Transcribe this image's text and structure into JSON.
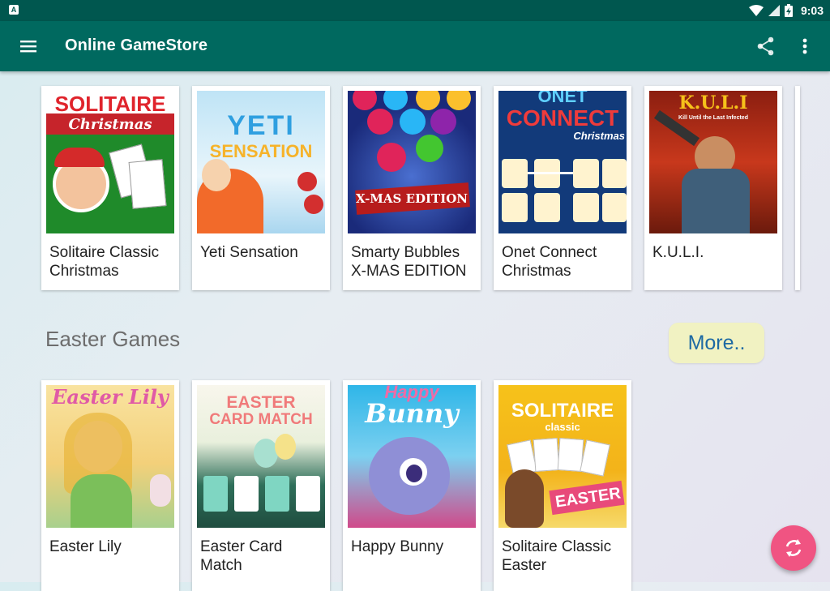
{
  "status_bar": {
    "time": "9:03",
    "left_icon_letter": "A"
  },
  "app_bar": {
    "title": "Online GameStore",
    "icons": [
      "menu-icon",
      "share-icon",
      "more-vert-icon"
    ]
  },
  "sections": [
    {
      "games": [
        {
          "title": "Solitaire Classic Christmas",
          "art": [
            "SOLITAIRE",
            "Christmas"
          ]
        },
        {
          "title": "Yeti Sensation",
          "art": [
            "YETI",
            "SENSATION"
          ]
        },
        {
          "title": "Smarty Bubbles X-MAS EDITION",
          "art": [
            "X-MAS EDITION"
          ]
        },
        {
          "title": "Onet Connect Christmas",
          "art": [
            "ONET",
            "CONNECT",
            "Christmas"
          ]
        },
        {
          "title": "K.U.L.I.",
          "art": [
            "K.U.L.I",
            "Kill Until the Last Infected"
          ]
        }
      ]
    },
    {
      "title": "Easter Games",
      "more_label": "More..",
      "games": [
        {
          "title": "Easter Lily",
          "art": [
            "Easter Lily"
          ]
        },
        {
          "title": "Easter Card Match",
          "art": [
            "EASTER",
            "CARD MATCH"
          ]
        },
        {
          "title": "Happy Bunny",
          "art": [
            "Happy",
            "Bunny"
          ]
        },
        {
          "title": "Solitaire Classic Easter",
          "art": [
            "SOLITAIRE",
            "classic",
            "EASTER"
          ]
        }
      ]
    }
  ],
  "fab": {
    "icon": "refresh-icon"
  },
  "colors": {
    "status_bar": "#00574f",
    "app_bar": "#00695f",
    "fab": "#f05482",
    "more_button": "#f1f2c2",
    "more_text": "#1e6aa3"
  }
}
